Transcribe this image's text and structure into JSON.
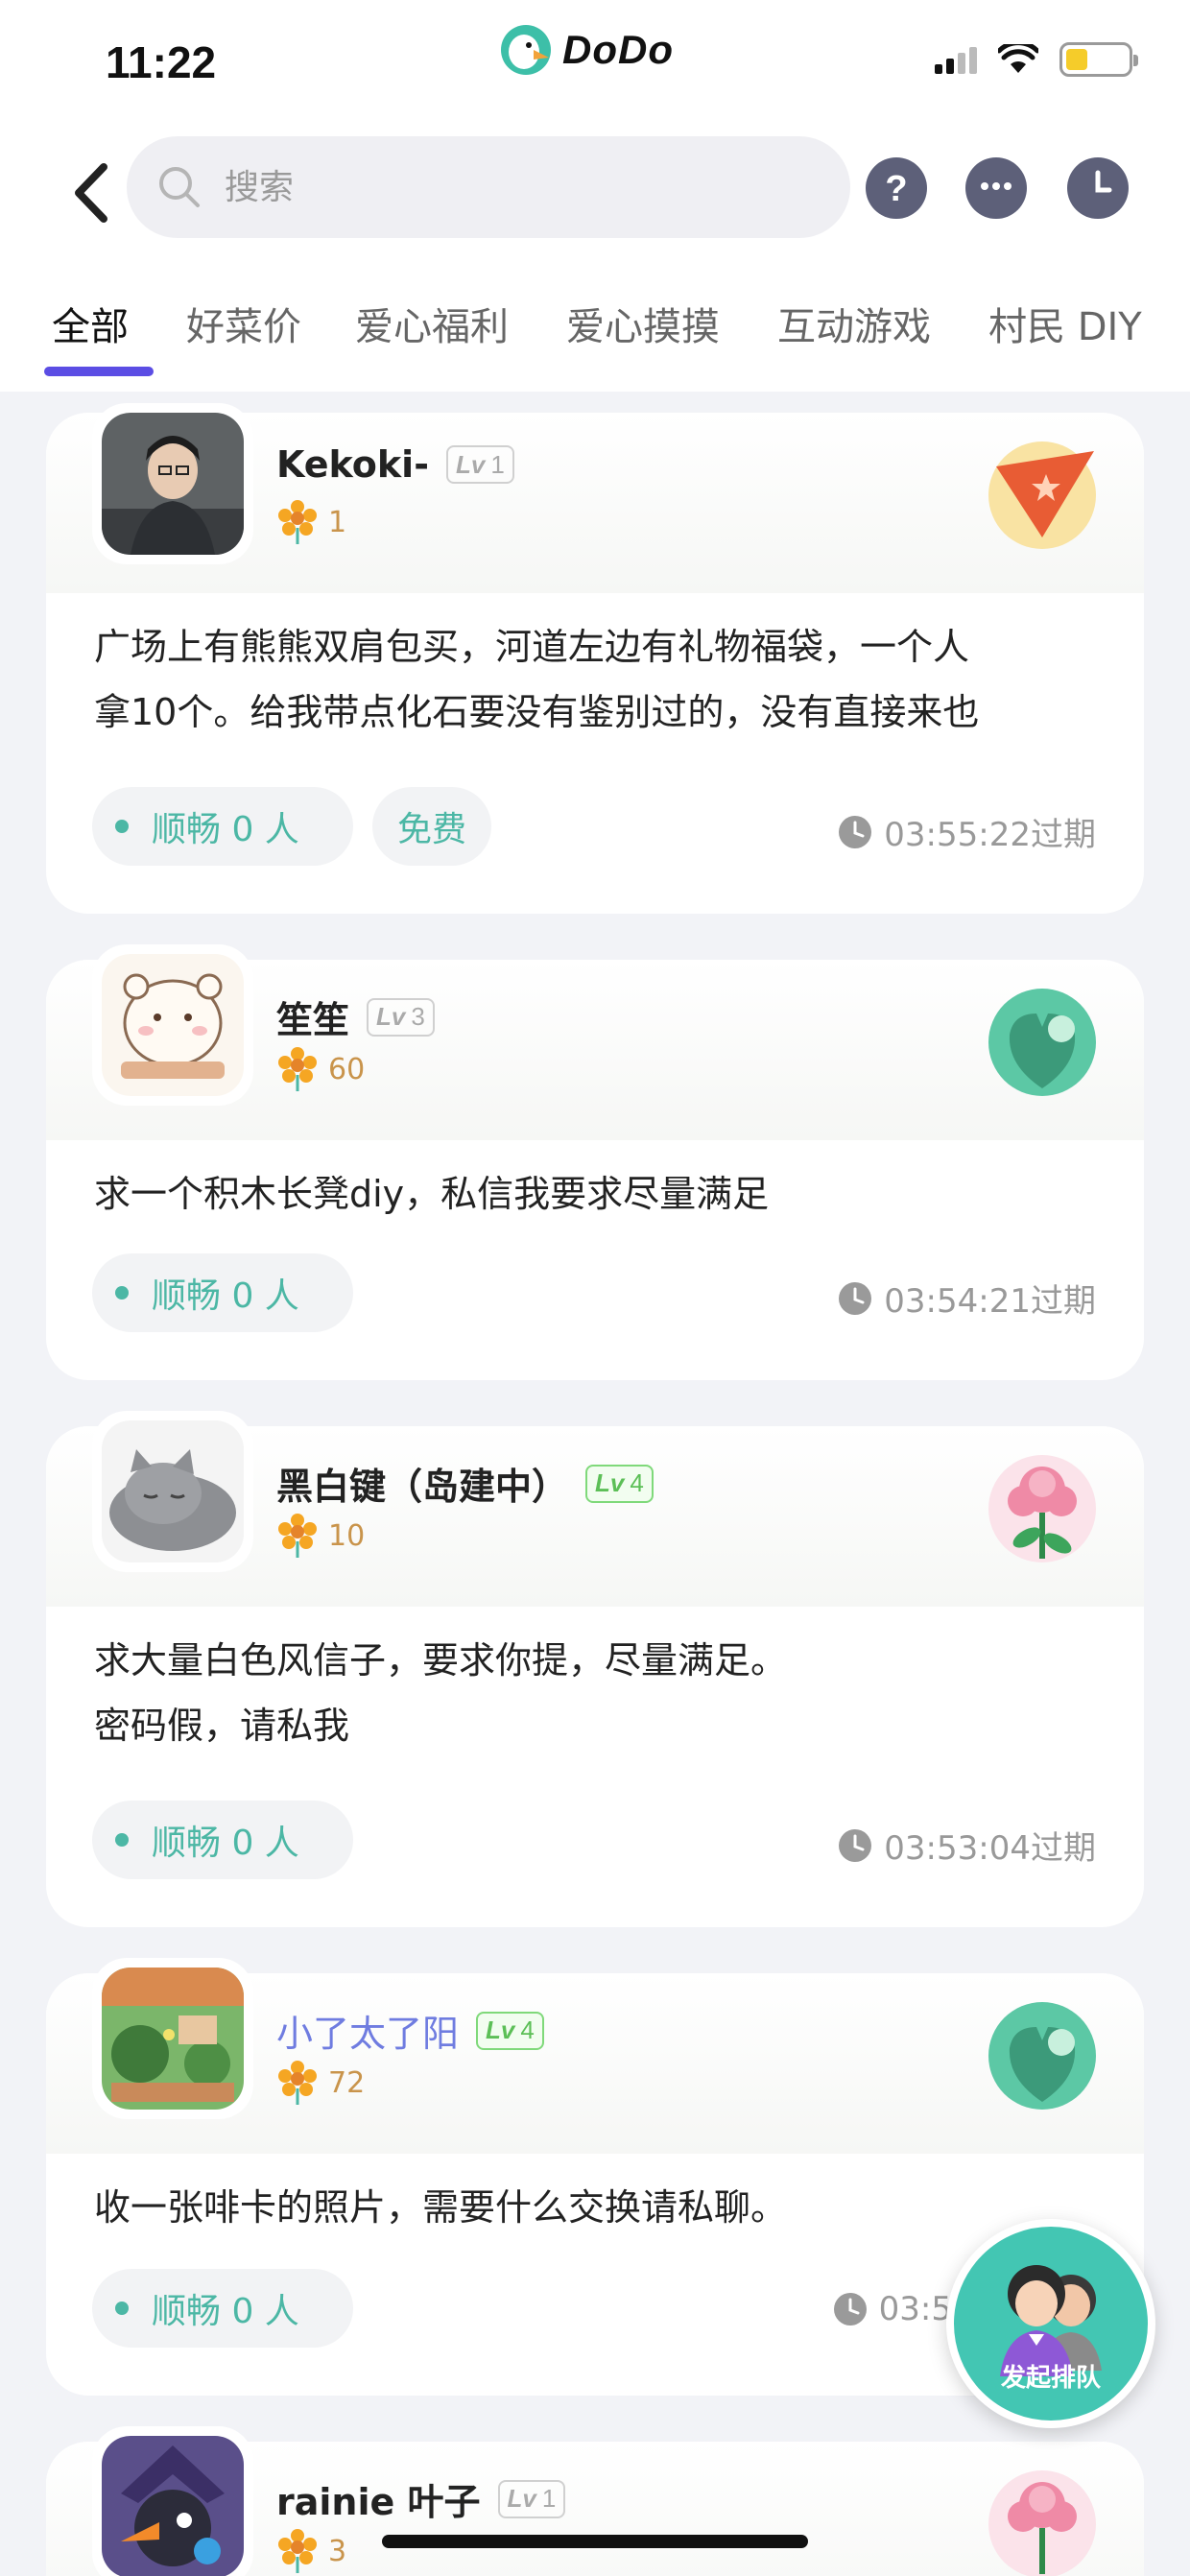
{
  "status_bar": {
    "time": "11:22",
    "brand": "DoDo"
  },
  "search": {
    "placeholder": "搜索"
  },
  "tabs": [
    {
      "label": "全部",
      "active": true
    },
    {
      "label": "好菜价"
    },
    {
      "label": "爱心福利"
    },
    {
      "label": "爱心摸摸"
    },
    {
      "label": "互动游戏"
    },
    {
      "label": "村民 DIY"
    }
  ],
  "posts": [
    {
      "username": "Kekoki-",
      "level": "1",
      "flowers": "1",
      "content": "广场上有熊熊双肩包买，河道左边有礼物福袋，一个人\n拿10个。给我带点化石要没有鉴别过的，没有直接来也",
      "queue": "顺畅 0 人",
      "tag": "免费",
      "expire": "03:55:22过期",
      "badge": "pennant-star-badge"
    },
    {
      "username": "笙笙",
      "level": "3",
      "flowers": "60",
      "content": "求一个积木长凳diy，私信我要求尽量满足",
      "queue": "顺畅 0 人",
      "expire": "03:54:21过期",
      "badge": "green-leaf-badge"
    },
    {
      "username": "黑白键（岛建中）",
      "level": "4",
      "flowers": "10",
      "content": "求大量白色风信子，要求你提，尽量满足。\n密码假，请私我",
      "queue": "顺畅 0 人",
      "expire": "03:53:04过期",
      "badge": "pink-flower-badge"
    },
    {
      "username": "小了太了阳",
      "level": "4",
      "flowers": "72",
      "content": "收一张啡卡的照片，需要什么交换请私聊。",
      "queue": "顺畅 0 人",
      "expire": "03:5",
      "badge": "green-leaf-badge"
    },
    {
      "username": "rainie 叶子",
      "level": "1",
      "flowers": "3",
      "badge": "pink-flower-badge"
    }
  ],
  "lv_prefix": "Lv",
  "fab": {
    "label": "发起排队"
  },
  "colors": {
    "accent": "#5b4de4",
    "queue_green": "#4cb7a5",
    "fab": "#43c6b3"
  }
}
